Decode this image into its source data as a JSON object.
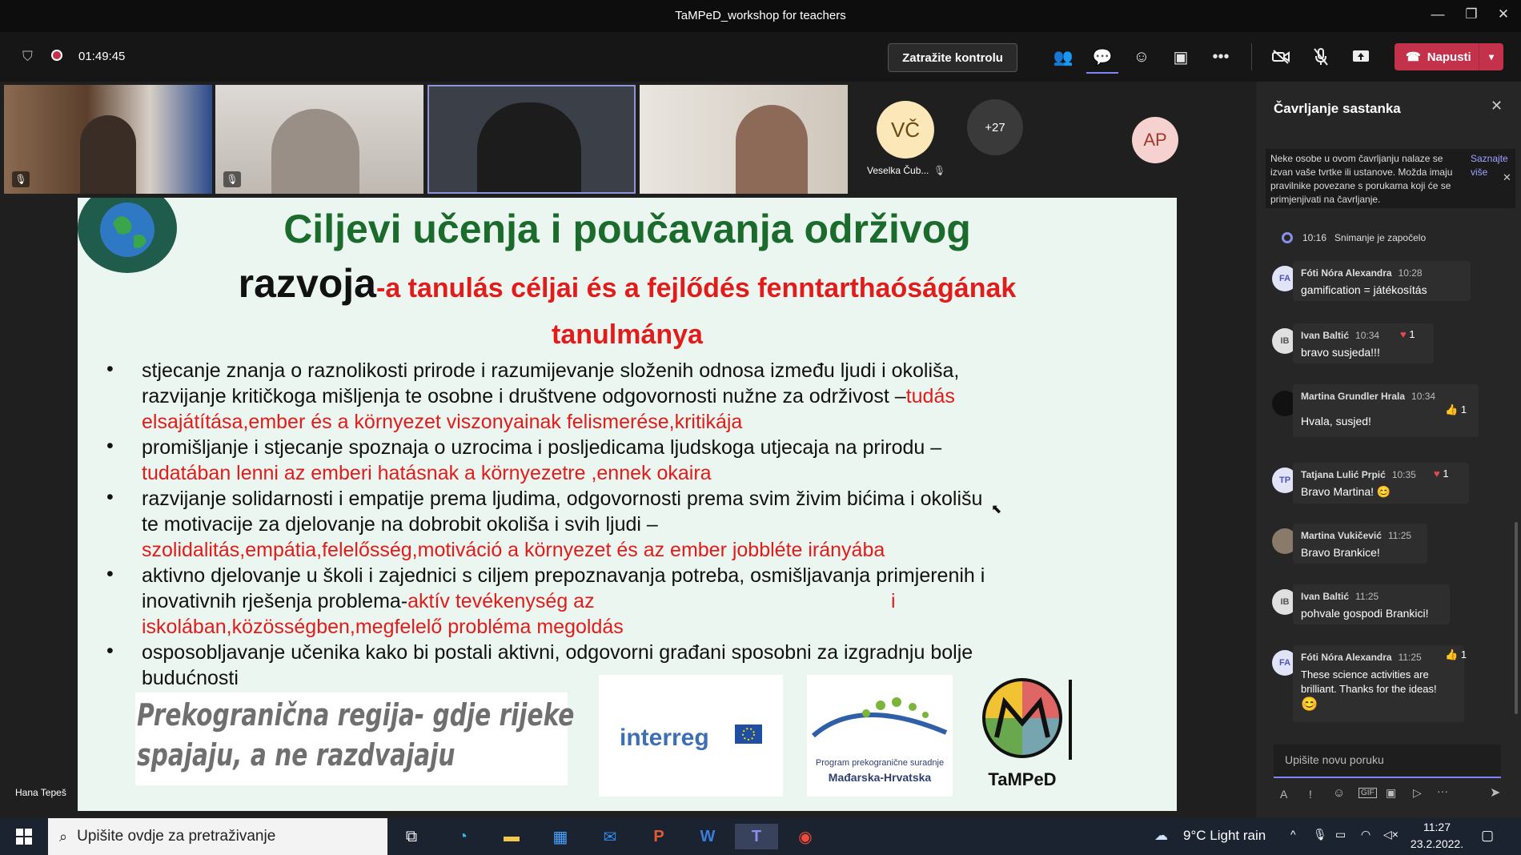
{
  "window": {
    "title": "TaMPeD_workshop for teachers"
  },
  "toolbar": {
    "timer": "01:49:45",
    "control_label": "Zatražite kontrolu",
    "leave_label": "Napusti"
  },
  "participants": {
    "initials_vc": "VČ",
    "name_vc": "Veselka Čub...",
    "more_count": "+27",
    "initials_ap": "AP",
    "speaker_name": "Hana Tepeš"
  },
  "slide": {
    "title_line1": "Ciljevi učenja i poučavanja održivog",
    "title_line2_hr": "razvoja",
    "title_line2_hu": "-a tanulás céljai és a fejlődés fenntarthaóságának",
    "title_line3_hu": "tanulmánya",
    "b1_l1": "stjecanje znanja o raznolikosti prirode i razumijevanje složenih odnosa između ljudi i okoliša,",
    "b1_l2": "razvijanje kritičkoga mišljenja te osobne i društvene odgovornosti nužne za održivost –",
    "b1_l2_red": "tudás",
    "b1_l3_red": "elsajátítása,ember és a környezet viszonyainak felismerése,kritikája",
    "b2_l1": "promišljanje i stjecanje spoznaja o uzrocima i posljedicama ljudskoga utjecaja na prirodu –",
    "b2_l2_red": "tudatában lenni az emberi hatásnak a környezetre ,ennek okaira",
    "b3_l1": "razvijanje solidarnosti i empatije prema ljudima, odgovornosti prema svim živim bićima i okolišu",
    "b3_l2": "te motivacije za djelovanje na dobrobit okoliša i svih ljudi –",
    "b3_l3_red": "szolidalitás,empátia,felelősség,motiváció a  környezet és az ember jobbléte irányába",
    "b4_l1": "aktivno djelovanje u školi i zajednici s ciljem prepoznavanja potreba, osmišljavanja primjerenih i",
    "b4_l2": "inovativnih rješenja problema-",
    "b4_l2_red": "aktív tevékenység az",
    "b4_l2_red2": "i",
    "b4_l3_red": "iskolában,közösségben,megfelelő probléma megoldás",
    "b5_l1": "osposobljavanje učenika kako bi postali aktivni, odgovorni građani sposobni za izgradnju bolje",
    "b5_l2": "budućnosti",
    "motto_l1": "Prekogranična regija- gdje rijeke",
    "motto_l2": "spajaju, a ne razdvajaju",
    "logo_interreg": "interreg",
    "logo_program_l1": "Program prekogranične suradnje",
    "logo_program_l2": "Mađarska-Hrvatska",
    "logo_tamped": "TaMPeD"
  },
  "chat": {
    "title": "Čavrljanje sastanka",
    "notice": "Neke osobe u ovom čavrljanju nalaze se izvan vaše tvrtke ili ustanove. Možda imaju pravilnike povezane s porukama koji će se primjenjivati na čavrljanje.",
    "notice_link": "Saznajte više",
    "system_time": "10:16",
    "system_text": "Snimanje je započelo",
    "messages": [
      {
        "initials": "FA",
        "name": "Fóti Nóra Alexandra",
        "time": "10:28",
        "text": "gamification = játékosítás",
        "reaction": ""
      },
      {
        "initials": "IB",
        "name": "Ivan Baltić",
        "time": "10:34",
        "text": "bravo susjeda!!!",
        "reaction": "1"
      },
      {
        "initials": "",
        "name": "Martina Grundler Hrala",
        "time": "10:34",
        "text": "Hvala, susjed!",
        "reaction": "1"
      },
      {
        "initials": "TP",
        "name": "Tatjana Lulić Prpić",
        "time": "10:35",
        "text": "Bravo Martina! 😊",
        "reaction": "1"
      },
      {
        "initials": "",
        "name": "Martina Vukičević",
        "time": "11:25",
        "text": "Bravo Brankice!",
        "reaction": ""
      },
      {
        "initials": "IB",
        "name": "Ivan Baltić",
        "time": "11:25",
        "text": "pohvale gospodi Brankici!",
        "reaction": ""
      },
      {
        "initials": "FA",
        "name": "Fóti Nóra Alexandra",
        "time": "11:25",
        "text": "These science activities are brilliant. Thanks for the ideas!",
        "reaction": "1"
      }
    ],
    "last_emoji": "😊",
    "input_placeholder": "Upišite novu poruku"
  },
  "taskbar": {
    "search_placeholder": "Upišite ovdje za pretraživanje",
    "weather": "9°C  Light rain",
    "time": "11:27",
    "date": "23.2.2022."
  },
  "colors": {
    "accent": "#6264a7",
    "leave": "#c4314b",
    "slide_title": "#1b6b2d",
    "slide_red": "#e21b1b"
  }
}
